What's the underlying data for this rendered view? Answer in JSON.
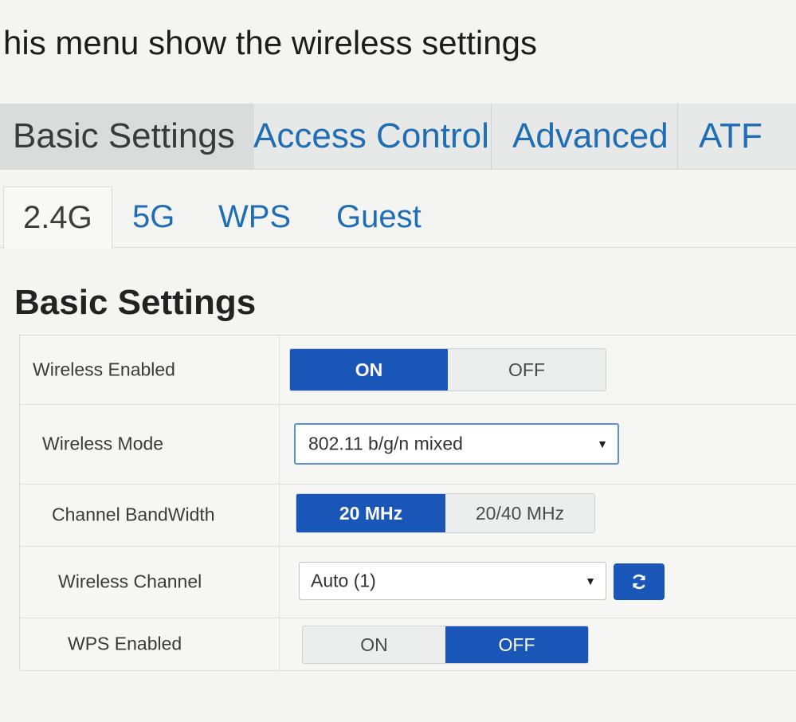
{
  "intro_text": "his menu show the wireless settings",
  "main_tabs": [
    {
      "label": "Basic Settings",
      "active": true
    },
    {
      "label": "Access Control",
      "active": false
    },
    {
      "label": "Advanced",
      "active": false
    },
    {
      "label": "ATF",
      "active": false
    }
  ],
  "sub_tabs": [
    {
      "label": "2.4G",
      "active": true
    },
    {
      "label": "5G",
      "active": false
    },
    {
      "label": "WPS",
      "active": false
    },
    {
      "label": "Guest",
      "active": false
    }
  ],
  "section_title": "Basic Settings",
  "settings": {
    "wireless_enabled": {
      "label": "Wireless Enabled",
      "on": "ON",
      "off": "OFF",
      "value": "ON"
    },
    "wireless_mode": {
      "label": "Wireless Mode",
      "value": "802.11 b/g/n mixed"
    },
    "channel_bandwidth": {
      "label": "Channel BandWidth",
      "opt1": "20 MHz",
      "opt2": "20/40 MHz",
      "value": "20 MHz"
    },
    "wireless_channel": {
      "label": "Wireless Channel",
      "value": "Auto (1)"
    },
    "wps_enabled": {
      "label": "WPS Enabled",
      "on": "ON",
      "off": "OFF",
      "value": "OFF"
    }
  },
  "colors": {
    "accent": "#1a56b8",
    "tab_link": "#1f6db5"
  },
  "icons": {
    "dropdown": "caret-down-icon",
    "refresh": "refresh-icon"
  }
}
